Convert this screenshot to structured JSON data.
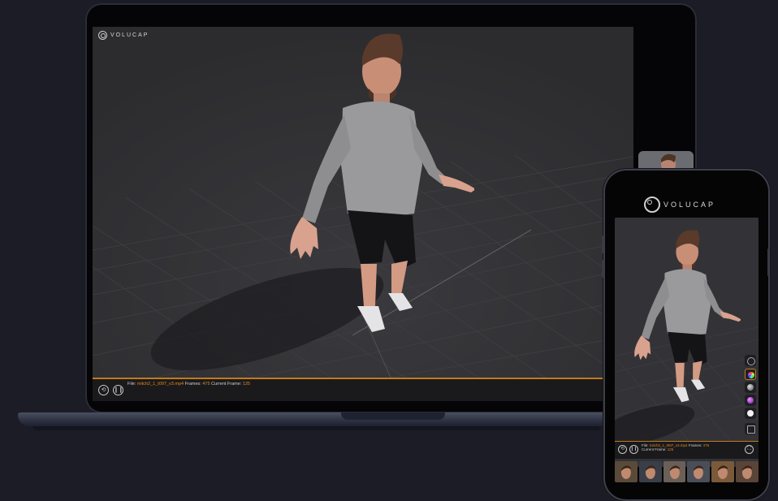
{
  "brand": {
    "logo_text": "VOLUCAP"
  },
  "laptop_player": {
    "file_label": "File:",
    "file_name": "mitch2_1_t097_v3.mp4",
    "frames_label": "Frames:",
    "frames_value": "475",
    "current_frame_label": "Current Frame:",
    "current_frame_value": "125",
    "controls": {
      "restart_icon": "restart-icon",
      "pause_icon": "pause-icon"
    }
  },
  "phone_player": {
    "file_label": "File:",
    "file_name": "mitch2_1_t097_v3.mp4",
    "frames_label": "Frames:",
    "frames_value": "475",
    "current_frame_label": "Current Frame:",
    "current_frame_value": "125",
    "tools": [
      "light-icon",
      "color-wheel-icon",
      "gray-sphere-icon",
      "gradient-sphere-icon",
      "white-sphere-icon",
      "share-icon"
    ],
    "fullscreen_icon": "fullscreen-icon",
    "thumbnails_count": 6
  },
  "colors": {
    "accent": "#e08a1e",
    "background": "#1c1c26",
    "viewport": "#2f2f32"
  }
}
